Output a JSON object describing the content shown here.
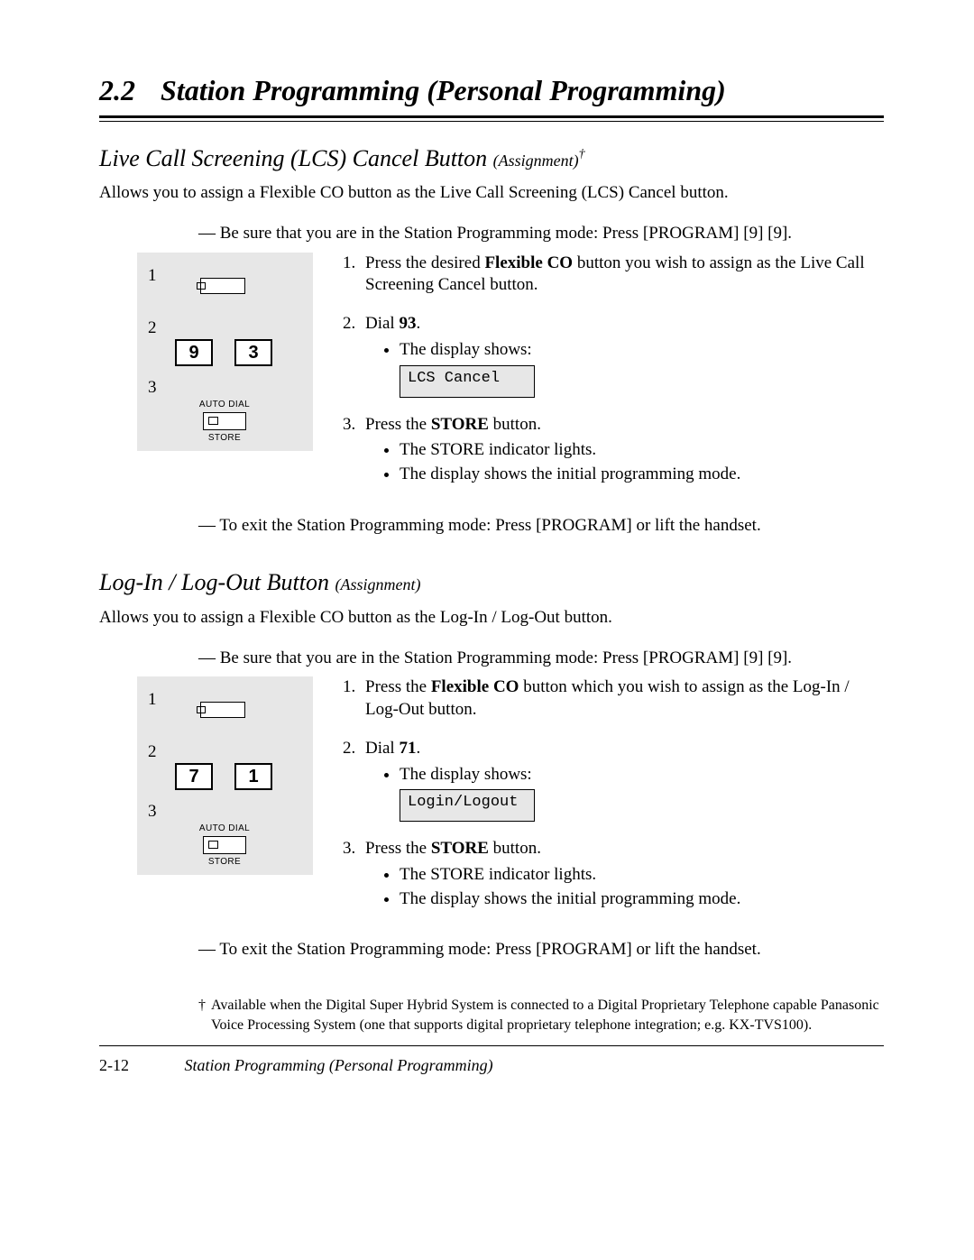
{
  "chapter": {
    "number": "2.2",
    "title": "Station Programming (Personal Programming)"
  },
  "sec1": {
    "heading_main": "Live Call Screening (LCS) Cancel Button ",
    "heading_sub": "(Assignment)",
    "dagger": "†",
    "intro": "Allows you to assign a Flexible CO button as the Live Call Screening (LCS) Cancel button.",
    "enter_mode": "— Be sure that you are in the Station Programming mode: Press [PROGRAM] [9] [9].",
    "exit_mode": "— To exit the Station Programming mode: Press [PROGRAM] or lift the handset.",
    "diagram": {
      "n1": "1",
      "n2": "2",
      "n3": "3",
      "key_a": "9",
      "key_b": "3",
      "label_top": "AUTO DIAL",
      "label_bottom": "STORE"
    },
    "steps": {
      "s1_pre": "Press the desired ",
      "s1_bold": "Flexible CO",
      "s1_post": " button you wish to assign as the Live Call Screening Cancel button.",
      "s2_pre": "Dial ",
      "s2_bold": "93",
      "s2_post": ".",
      "s2_bullet": "The display shows:",
      "s2_display": "LCS Cancel",
      "s3_pre": "Press the ",
      "s3_bold": "STORE",
      "s3_post": " button.",
      "s3_b1": "The STORE indicator lights.",
      "s3_b2": "The display shows the initial programming mode."
    }
  },
  "sec2": {
    "heading_main": "Log-In / Log-Out Button ",
    "heading_sub": "(Assignment)",
    "intro": "Allows you to assign a Flexible CO button as the Log-In / Log-Out button.",
    "enter_mode": "— Be sure that you are in the Station Programming mode: Press [PROGRAM] [9] [9].",
    "exit_mode": "— To exit the Station Programming mode: Press [PROGRAM] or lift the handset.",
    "diagram": {
      "n1": "1",
      "n2": "2",
      "n3": "3",
      "key_a": "7",
      "key_b": "1",
      "label_top": "AUTO DIAL",
      "label_bottom": "STORE"
    },
    "steps": {
      "s1_pre": "Press the ",
      "s1_bold": "Flexible CO",
      "s1_post": " button which you wish to assign as the Log-In / Log-Out button.",
      "s2_pre": "Dial ",
      "s2_bold": "71",
      "s2_post": ".",
      "s2_bullet": "The display shows:",
      "s2_display": "Login/Logout",
      "s3_pre": "Press the ",
      "s3_bold": "STORE",
      "s3_post": " button.",
      "s3_b1": "The STORE indicator lights.",
      "s3_b2": "The display shows the initial programming mode."
    }
  },
  "footnote": {
    "dagger": "†",
    "text": "Available when the Digital Super Hybrid System is connected to a Digital Proprietary Telephone capable Panasonic Voice Processing System (one that supports digital proprietary telephone integration; e.g. KX-TVS100)."
  },
  "footer": {
    "page": "2-12",
    "title": "Station Programming (Personal Programming)"
  }
}
